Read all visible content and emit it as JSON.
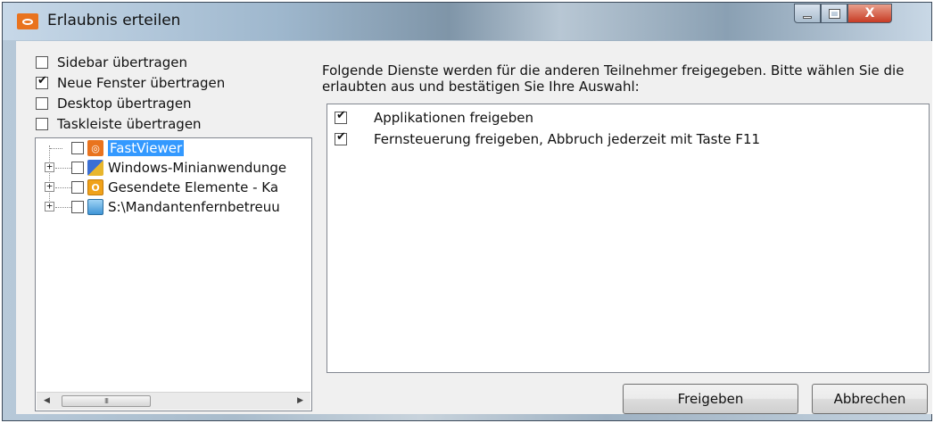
{
  "window": {
    "title": "Erlaubnis erteilen",
    "close_glyph": "X"
  },
  "options": [
    {
      "label": "Sidebar übertragen",
      "checked": false
    },
    {
      "label": "Neue Fenster übertragen",
      "checked": true
    },
    {
      "label": "Desktop übertragen",
      "checked": false
    },
    {
      "label": "Taskleiste übertragen",
      "checked": false
    }
  ],
  "tree": {
    "items": [
      {
        "label": "FastViewer",
        "icon": "fastviewer-icon",
        "expander": "",
        "selected": true
      },
      {
        "label": "Windows-Minianwendunge",
        "icon": "windows-gadget-icon",
        "expander": "+"
      },
      {
        "label": "Gesendete Elemente - Ka",
        "icon": "outlook-icon",
        "expander": "+"
      },
      {
        "label": "S:\\Mandantenfernbetreuu",
        "icon": "network-drive-icon",
        "expander": "+"
      }
    ],
    "scrollbar": {
      "left_arrow": "◀",
      "right_arrow": "▶",
      "grip": "III"
    }
  },
  "description": "Folgende Dienste werden für die anderen Teilnehmer freigegeben. Bitte wählen Sie die erlaubten aus und bestätigen Sie Ihre Auswahl:",
  "services": [
    {
      "label": "Applikationen freigeben",
      "checked": true
    },
    {
      "label": "Fernsteuerung freigeben, Abbruch jederzeit mit Taste F11",
      "checked": true
    }
  ],
  "buttons": {
    "ok": "Freigeben",
    "cancel": "Abbrechen"
  },
  "colors": {
    "selection": "#3399ff",
    "app_accent": "#e9731e",
    "close_button": "#c73b24"
  }
}
